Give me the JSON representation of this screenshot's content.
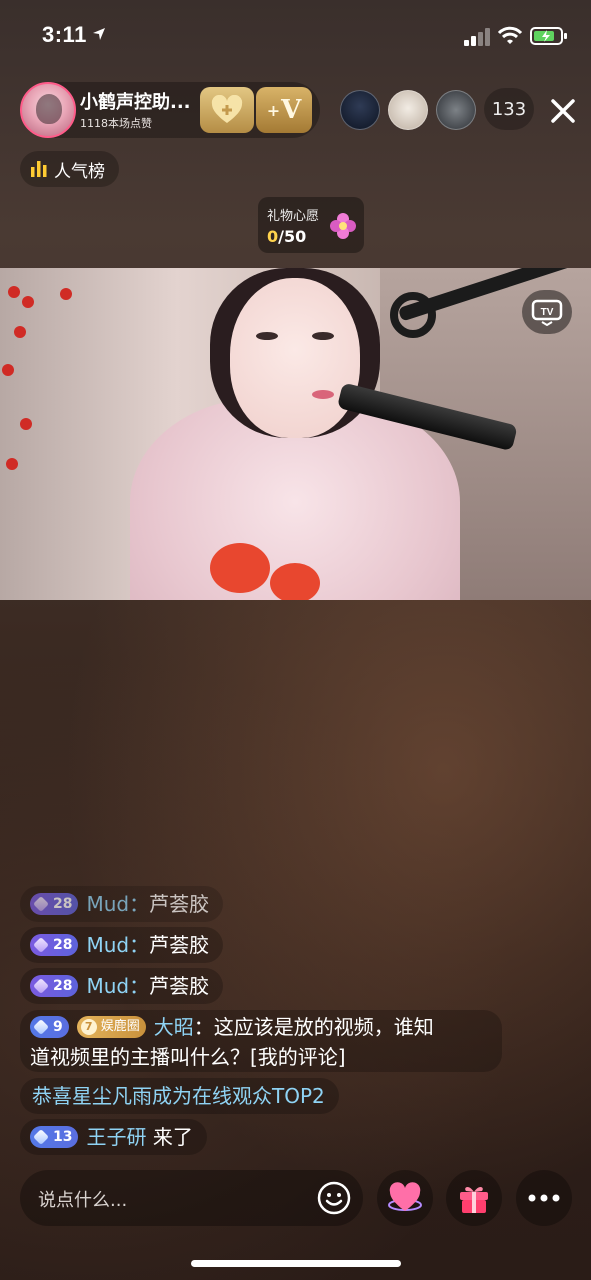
{
  "status_bar": {
    "time": "3:11"
  },
  "host": {
    "name": "小鹤声控助...",
    "likes": "1118本场点赞"
  },
  "fan_badge": {
    "label": "+V"
  },
  "viewers": {
    "count": "133"
  },
  "rank": {
    "label": "人气榜"
  },
  "gift_wish": {
    "title": "礼物心愿",
    "current": "0",
    "total": "/50"
  },
  "chat": [
    {
      "level": "28",
      "user": "Mud",
      "text": "芦荟胶"
    },
    {
      "level": "28",
      "user": "Mud",
      "text": "芦荟胶"
    },
    {
      "level": "28",
      "user": "Mud",
      "text": "芦荟胶"
    }
  ],
  "chat_long": {
    "level": "9",
    "club_level": "7",
    "club": "娱鹿圈",
    "user": "大昭",
    "line1": "这应该是放的视频，谁知",
    "line2": "道视频里的主播叫什么？[我的评论]"
  },
  "system_message": "恭喜星尘凡雨成为在线观众TOP2",
  "join_message": {
    "level": "13",
    "user": "王子研",
    "text": "来了"
  },
  "input": {
    "placeholder": "说点什么..."
  },
  "colors": {
    "username": "#8fd3f4",
    "accent_pink": "#ff5c8a",
    "wish_current": "#ffd34d"
  },
  "icons": [
    "location-arrow-icon",
    "signal-icon",
    "wifi-icon",
    "battery-icon",
    "close-icon",
    "rank-bars-icon",
    "flower-gift-icon",
    "tv-icon",
    "emoji-icon",
    "heart-icon",
    "gift-icon",
    "more-icon"
  ]
}
